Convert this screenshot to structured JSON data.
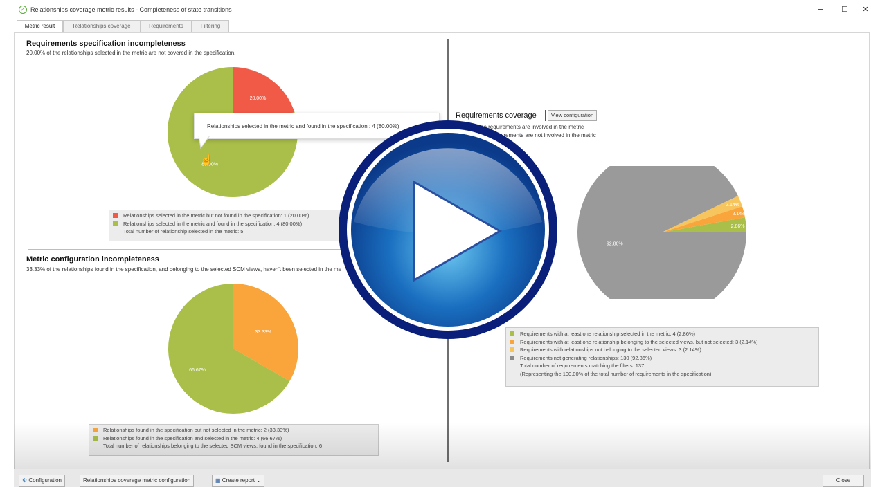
{
  "window": {
    "title": "Relationships coverage metric results - Completeness of state transitions",
    "minimize": "–",
    "maximize": "☐",
    "close": "✕"
  },
  "tabs": [
    "Metric result",
    "Relationships coverage",
    "Requirements",
    "Filtering"
  ],
  "spec_incompleteness": {
    "heading": "Requirements specification incompleteness",
    "subtitle": "20.00% of the relationships selected in the metric are not covered in the specification.",
    "tooltip": "Relationships selected in the metric and found in the specification : 4 (80.00%)",
    "slices": [
      {
        "label": "20.00%",
        "value": 20,
        "color": "#f15a47"
      },
      {
        "label": "80.00%",
        "value": 80,
        "color": "#a9bf4a"
      }
    ],
    "legend": [
      {
        "text": "Relationships selected in the metric but not found in the specification: 1  (20.00%)",
        "color": "#f15a47"
      },
      {
        "text": "Relationships selected in the metric and found in the specification: 4  (80.00%)",
        "color": "#a9bf4a"
      },
      {
        "text": "Total number of relationship selected in the metric: 5",
        "color": ""
      }
    ]
  },
  "config_incompleteness": {
    "heading": "Metric configuration incompleteness",
    "subtitle": "33.33% of the relationships found in the specification, and belonging to the selected SCM views, haven't been selected in the metric.",
    "slices": [
      {
        "label": "33.33%",
        "value": 33.33,
        "color": "#f9a53c"
      },
      {
        "label": "66.67%",
        "value": 66.67,
        "color": "#a9bf4a"
      }
    ],
    "legend": [
      {
        "text": "Relationships found in the specification but not selected in the metric: 2  (33.33%)",
        "color": "#f9a53c"
      },
      {
        "text": "Relationships found in the specification and selected in the metric: 4  (66.67%)",
        "color": "#a9bf4a"
      },
      {
        "text": "Total number of relationships belonging to the selected SCM views, found in the specification: 6",
        "color": ""
      }
    ]
  },
  "req_coverage": {
    "heading": "Requirements coverage",
    "view_config": "View configuration",
    "line1": "7.14% of the requirements are involved in the metric",
    "line2": "92.86% of the requirements are not involved in the metric",
    "slices": [
      {
        "label": "92.86%",
        "value": 92.86,
        "color": "#9a9a9a"
      },
      {
        "label": "2.14%",
        "value": 2.14,
        "color": "#f7c55e"
      },
      {
        "label": "2.14%",
        "value": 2.14,
        "color": "#f9a53c"
      },
      {
        "label": "2.86%",
        "value": 2.86,
        "color": "#a9bf4a"
      }
    ],
    "legend": [
      {
        "text": "Requirements with at least one relationship selected in the metric: 4  (2.86%)",
        "color": "#a9bf4a"
      },
      {
        "text": "Requirements with at least one relationship belonging to the selected views, but not selected: 3  (2.14%)",
        "color": "#f9a53c"
      },
      {
        "text": "Requirements with relationships not belonging to the selected views: 3  (2.14%)",
        "color": "#f7c55e"
      },
      {
        "text": "Requirements not generating relationships: 130  (92.86%)",
        "color": "#8a8a8a"
      },
      {
        "text": "Total number of requirements matching the filters: 137",
        "color": ""
      },
      {
        "text": "(Representing the 100.00% of the total number of requirements in the specification)",
        "color": ""
      }
    ]
  },
  "bottom": {
    "configuration": "Configuration",
    "rel_config": "Relationships coverage metric configuration",
    "create_report": "Create report ⌄",
    "close": "Close"
  }
}
